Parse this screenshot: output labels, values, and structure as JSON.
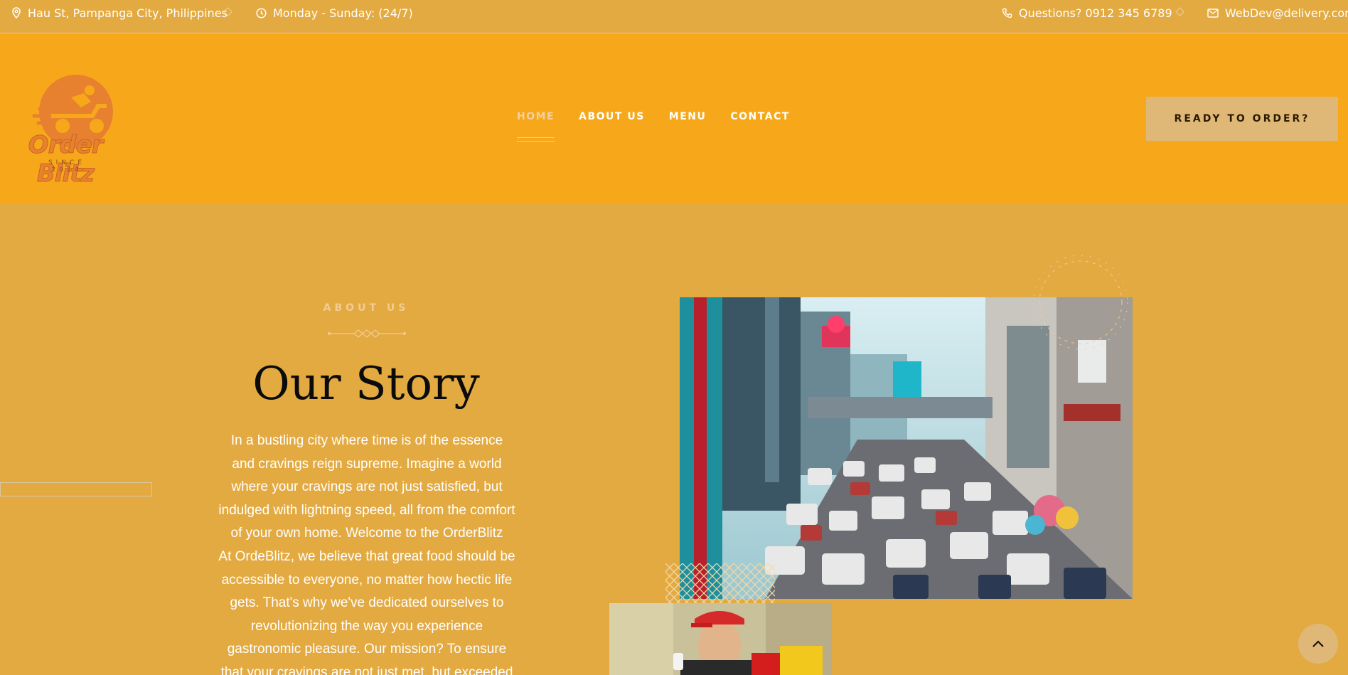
{
  "topbar": {
    "address": "Hau St, Pampanga City, Philippines",
    "hours": "Monday - Sunday: (24/7)",
    "phone": "Questions? 0912 345 6789",
    "email": "WebDev@delivery.com"
  },
  "brand": {
    "name": "Order Blitz",
    "since": "SINCE 2024"
  },
  "nav": {
    "items": [
      {
        "label": "HOME",
        "active": true
      },
      {
        "label": "ABOUT US",
        "active": false
      },
      {
        "label": "MENU",
        "active": false
      },
      {
        "label": "CONTACT",
        "active": false
      }
    ],
    "cta_label": "READY TO ORDER?"
  },
  "about": {
    "kicker": "ABOUT US",
    "title": "Our Story",
    "paragraphs": [
      "In a bustling city where time is of the essence and cravings reign supreme. Imagine a world where your cravings are not just satisfied, but indulged with lightning speed, all from the comfort of your own home. Welcome to the OrderBlitz",
      "At OrdeBlitz, we believe that great food should be accessible to everyone, no matter how hectic life gets. That's why we've dedicated ourselves to revolutionizing the way you experience gastronomic pleasure. Our mission? To ensure that your cravings are not just met, but exceeded"
    ]
  },
  "colors": {
    "background": "#e3aa42",
    "header": "#f6a81a",
    "cta": "#dfb878",
    "accent": "#e8812f"
  },
  "icons": [
    "map-pin-icon",
    "clock-icon",
    "phone-icon",
    "mail-icon",
    "chevron-up-icon"
  ]
}
